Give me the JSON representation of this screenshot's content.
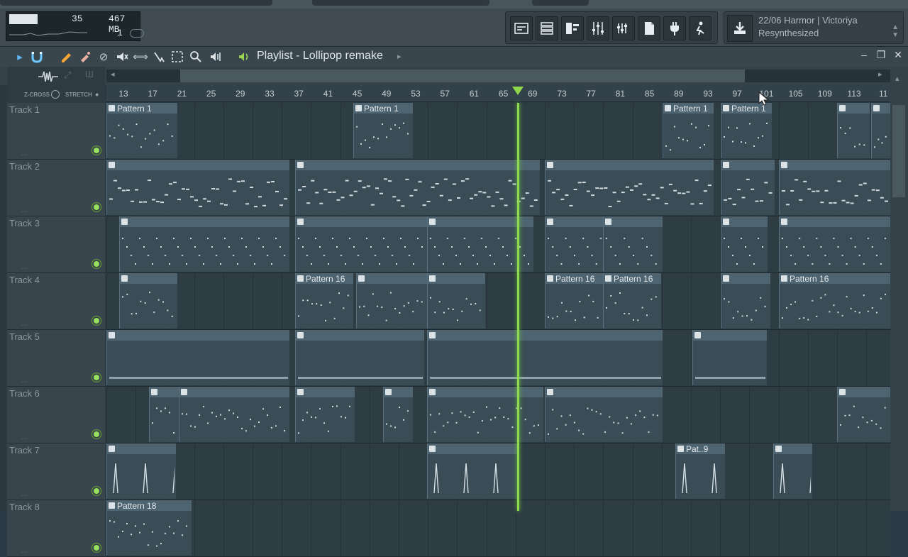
{
  "toolbar": {
    "cpu": "35",
    "memory": "467 MB",
    "polyphony": "1",
    "tool_buttons": [
      "playlist-icon",
      "channel-rack-icon",
      "piano-roll-icon",
      "mixer-icon",
      "plugin-picker-icon",
      "browser-icon",
      "plugin-icon",
      "performance-icon",
      "tempo-icon"
    ],
    "hint_line1": "22/06  Harmor | Victoriya",
    "hint_line2": "Resynthesized"
  },
  "window": {
    "title": "Playlist - Lollipop remake",
    "left_labels": {
      "zcross": "Z-CROSS",
      "stretch": "STRETCH"
    }
  },
  "ruler": {
    "bars": [
      "13",
      "17",
      "21",
      "25",
      "29",
      "33",
      "37",
      "41",
      "45",
      "49",
      "53",
      "57",
      "61",
      "65",
      "69",
      "73",
      "77",
      "81",
      "85",
      "89",
      "93",
      "97",
      "101",
      "105",
      "109",
      "113",
      "11"
    ]
  },
  "tracks": [
    {
      "name": "Track 1",
      "clips": [
        {
          "label": "Pattern 1"
        },
        {
          "label": "Pattern 1"
        },
        {
          "label": "Pattern 1"
        },
        {
          "label": "Pattern 1"
        },
        {
          "label": ""
        },
        {
          "label": ""
        }
      ]
    },
    {
      "name": "Track 2",
      "clips": [
        {
          "label": ""
        },
        {
          "label": ""
        },
        {
          "label": ""
        },
        {
          "label": ""
        },
        {
          "label": ""
        }
      ]
    },
    {
      "name": "Track 3",
      "clips": [
        {
          "label": ""
        },
        {
          "label": ""
        },
        {
          "label": ""
        },
        {
          "label": ""
        },
        {
          "label": ""
        },
        {
          "label": ""
        },
        {
          "label": ""
        }
      ]
    },
    {
      "name": "Track 4",
      "clips": [
        {
          "label": ""
        },
        {
          "label": "Pattern 16"
        },
        {
          "label": ""
        },
        {
          "label": ""
        },
        {
          "label": "Pattern 16"
        },
        {
          "label": "Pattern 16"
        },
        {
          "label": ""
        },
        {
          "label": "Pattern 16"
        }
      ]
    },
    {
      "name": "Track 5",
      "clips": [
        {
          "label": ""
        },
        {
          "label": ""
        },
        {
          "label": ""
        },
        {
          "label": ""
        }
      ]
    },
    {
      "name": "Track 6",
      "clips": [
        {
          "label": ""
        },
        {
          "label": ""
        },
        {
          "label": ""
        },
        {
          "label": ""
        },
        {
          "label": ""
        },
        {
          "label": ""
        },
        {
          "label": ""
        }
      ]
    },
    {
      "name": "Track 7",
      "clips": [
        {
          "label": ""
        },
        {
          "label": ""
        },
        {
          "label": "Pat..9"
        },
        {
          "label": ""
        }
      ]
    },
    {
      "name": "Track 8",
      "clips": [
        {
          "label": "Pattern 18"
        }
      ]
    }
  ]
}
